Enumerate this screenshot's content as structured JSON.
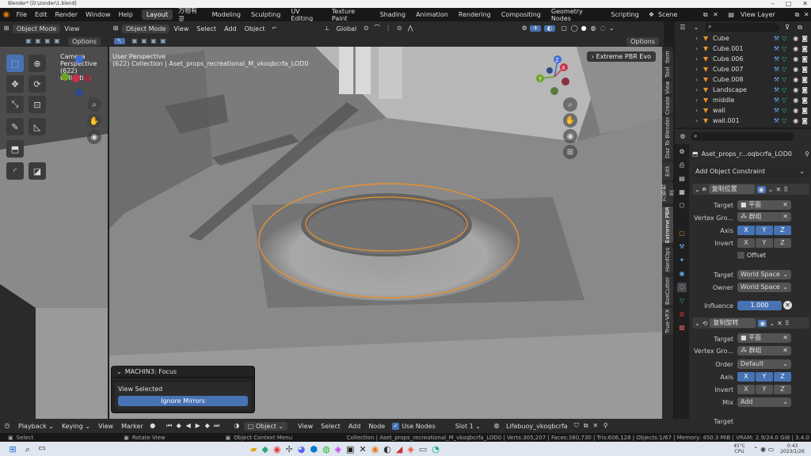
{
  "window": {
    "title": "Blender* [D:\\zonder\\1.blend]"
  },
  "menu": [
    "File",
    "Edit",
    "Render",
    "Window",
    "Help"
  ],
  "workspaces": [
    {
      "label": "Layout",
      "active": true
    },
    {
      "label": "万物有灵",
      "active": false
    },
    {
      "label": "Modeling",
      "active": false
    },
    {
      "label": "Sculpting",
      "active": false
    },
    {
      "label": "UV Editing",
      "active": false
    },
    {
      "label": "Texture Paint",
      "active": false
    },
    {
      "label": "Shading",
      "active": false
    },
    {
      "label": "Animation",
      "active": false
    },
    {
      "label": "Rendering",
      "active": false
    },
    {
      "label": "Compositing",
      "active": false
    },
    {
      "label": "Geometry Nodes",
      "active": false
    },
    {
      "label": "Scripting",
      "active": false
    }
  ],
  "scene": {
    "label": "Scene"
  },
  "view_layer": {
    "label": "View Layer"
  },
  "left_view": {
    "mode": "Object Mode",
    "view": "View",
    "options": "Options",
    "overlay_line1": "Camera Perspective",
    "overlay_line2": "(622) Collection"
  },
  "main_view": {
    "mode": "Object Mode",
    "menu": [
      "View",
      "Select",
      "Add",
      "Object"
    ],
    "transform": "Global",
    "options": "Options",
    "overlay_line1": "User Perspective",
    "overlay_line2": "(622) Collection | Aset_props_recreational_M_vkoqbcrfa_LOD0",
    "render_badge": "Extreme PBR Evo",
    "gizmo": {
      "x": "X",
      "y": "Y",
      "z": "Z"
    }
  },
  "side_tabs": [
    "Item",
    "Tool",
    "View",
    "Create",
    "Daz To Blender",
    "Edit",
    "万物有灵",
    "Extreme PBR",
    "HardOps",
    "BoxCutter",
    "True-VFX"
  ],
  "focus_panel": {
    "title": "MACHIN3: Focus",
    "view_selected": "View Selected",
    "ignore_mirrors": "Ignore Mirrors"
  },
  "outliner": {
    "items": [
      "Cube",
      "Cube.001",
      "Cube.006",
      "Cube.007",
      "Cube.008",
      "Landscape",
      "middle",
      "wall",
      "wall.001"
    ]
  },
  "properties": {
    "object_name": "Aset_props_r...oqbcrfa_LOD0",
    "add_constraint": "Add Object Constraint",
    "c1": {
      "name": "复制位置",
      "target_label": "Target",
      "target_value": "平面",
      "vgroup_label": "Vertex Gro...",
      "vgroup_value": "群组",
      "axis_label": "Axis",
      "invert_label": "Invert",
      "offset": "Offset",
      "target_space_label": "Target",
      "target_space": "World Space",
      "owner_space_label": "Owner",
      "owner_space": "World Space",
      "influence_label": "Influence",
      "influence": "1.000"
    },
    "c2": {
      "name": "复制旋转",
      "target_label": "Target",
      "target_value": "平面",
      "vgroup_label": "Vertex Gro...",
      "vgroup_value": "群组",
      "order_label": "Order",
      "order_value": "Default",
      "axis_label": "Axis",
      "invert_label": "Invert",
      "mix_label": "Mix",
      "mix_value": "Add",
      "target_space_label": "Target",
      "target_space": "World Space"
    },
    "axes": [
      "X",
      "Y",
      "Z"
    ]
  },
  "timeline": {
    "menu": [
      "Playback",
      "Keying",
      "View",
      "Marker"
    ],
    "editor": "Object",
    "editor_menu": [
      "View",
      "Select",
      "Add",
      "Node"
    ],
    "use_nodes": "Use Nodes",
    "slot": "Slot 1",
    "material": "Lifebuoy_vkoqbcrfa"
  },
  "status": {
    "select": "Select",
    "rotate": "Rotate View",
    "context": "Object Context Menu",
    "stats": "Collection | Aset_props_recreational_M_vkoqbcrfa_LOD0 | Verts:305,207 | Faces:380,730 | Tris:606,128 | Objects:1/67 | Memory: 450.3 MiB | VRAM: 2.9/24.0 GiB | 3.4.0"
  },
  "taskbar": {
    "temp": "45°C",
    "cpu": "CPU",
    "time": "0:43",
    "date": "2023/1/26"
  }
}
